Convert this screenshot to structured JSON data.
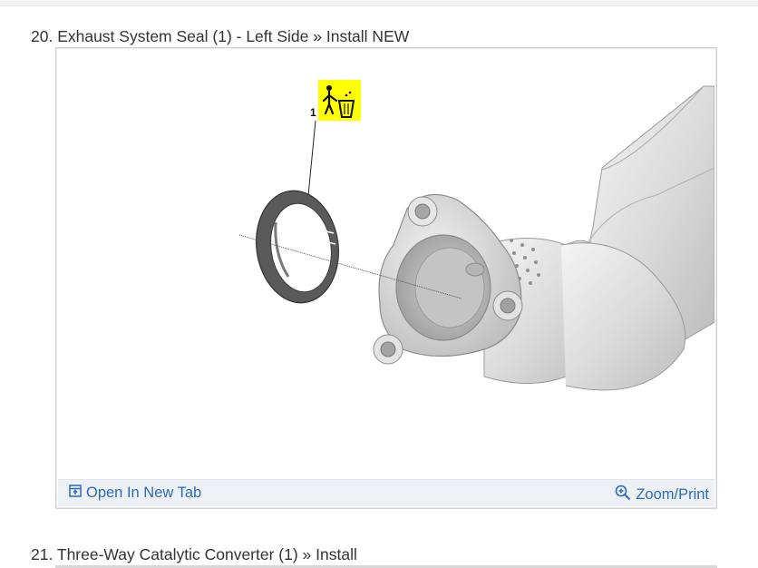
{
  "steps": [
    {
      "heading": "20. Exhaust System Seal (1) - Left Side » Install NEW"
    },
    {
      "heading": "21. Three-Way Catalytic Converter (1) » Install"
    }
  ],
  "figure": {
    "callout_number": "1",
    "disposal_icon": "trash-disposal-icon",
    "disposal_color": "#ffff00",
    "open_tab_label": "Open In New Tab",
    "open_tab_icon": "open-in-new-tab-icon",
    "zoom_label": "Zoom/Print",
    "zoom_icon": "zoom-in-icon",
    "link_color": "#2a6bb8"
  }
}
